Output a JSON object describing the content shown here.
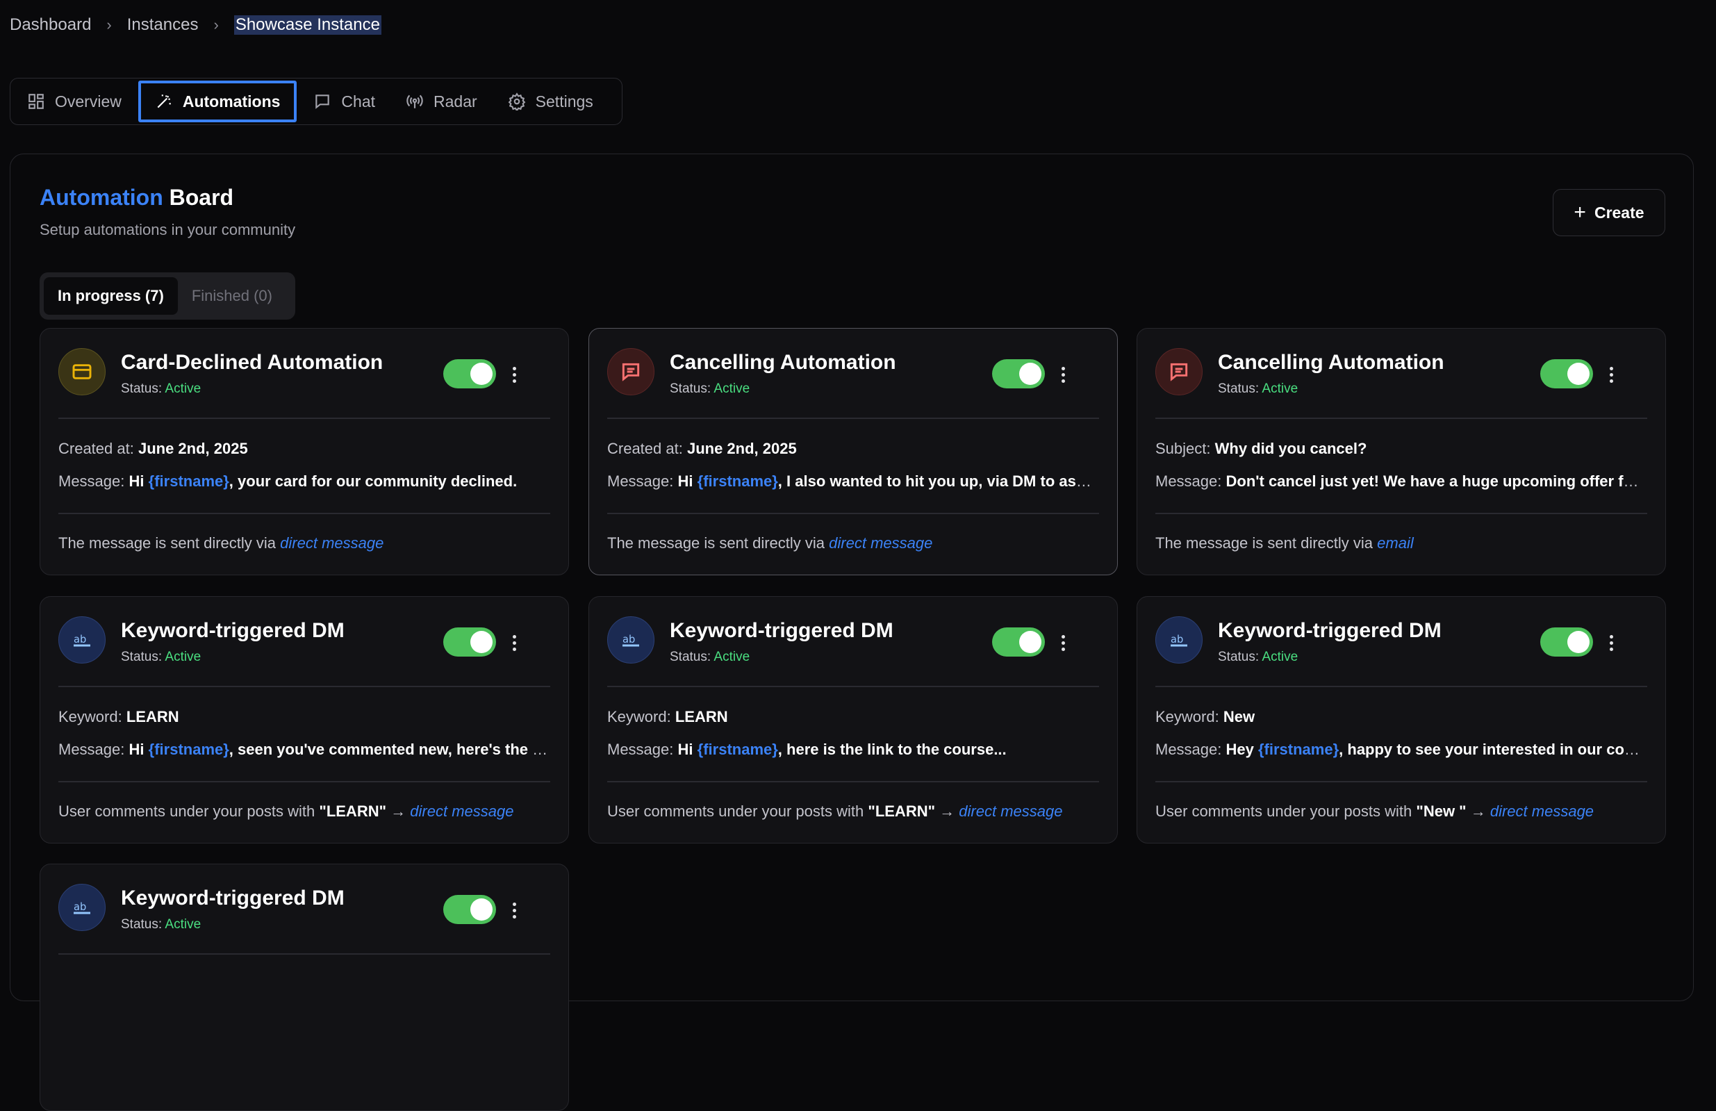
{
  "breadcrumb": {
    "items": [
      "Dashboard",
      "Instances",
      "Showcase Instance"
    ]
  },
  "tabs": [
    {
      "label": "Overview",
      "icon": "grid-icon"
    },
    {
      "label": "Automations",
      "icon": "magic-wand-icon",
      "active": true
    },
    {
      "label": "Chat",
      "icon": "chat-icon"
    },
    {
      "label": "Radar",
      "icon": "radar-icon"
    },
    {
      "label": "Settings",
      "icon": "gear-icon"
    }
  ],
  "board": {
    "title_accent": "Automation",
    "title_rest": "Board",
    "subtitle": "Setup automations in your community",
    "create_label": "Create",
    "segments": [
      "In progress (7)",
      "Finished (0)"
    ]
  },
  "cards": [
    {
      "title": "Card-Declined Automation",
      "status_label": "Status:",
      "status": "Active",
      "icon": "credit-card-icon",
      "r1_label": "Created at:",
      "r1_value": "June 2nd, 2025",
      "r2_label": "Message:",
      "r2_pre": "Hi",
      "r2_var": "{firstname}",
      "r2_rest": ", your card for our community declined.",
      "foot_text": "The message is sent directly via",
      "foot_kw": "",
      "foot_arrow": "",
      "foot_via": "direct message"
    },
    {
      "title": "Cancelling Automation",
      "status_label": "Status:",
      "status": "Active",
      "icon": "message-square-icon",
      "r1_label": "Created at:",
      "r1_value": "June 2nd, 2025",
      "r2_label": "Message:",
      "r2_pre": "Hi",
      "r2_var": "{firstname}",
      "r2_rest": ", I also wanted to hit you up, via DM to ask why you cancelled",
      "foot_text": "The message is sent directly via",
      "foot_kw": "",
      "foot_arrow": "",
      "foot_via": "direct message"
    },
    {
      "title": "Cancelling Automation",
      "status_label": "Status:",
      "status": "Active",
      "icon": "message-square-icon",
      "r1_label": "Subject:",
      "r1_value": "Why did you cancel?",
      "r2_label": "Message:",
      "r2_pre": "Don't cancel just yet! We have a huge upcoming offer for you",
      "r2_var": "",
      "r2_rest": "",
      "foot_text": "The message is sent directly via",
      "foot_kw": "",
      "foot_arrow": "",
      "foot_via": "email"
    },
    {
      "title": "Keyword-triggered DM",
      "status_label": "Status:",
      "status": "Active",
      "icon": "text-ab-icon",
      "r1_label": "Keyword:",
      "r1_value": "LEARN",
      "r2_label": "Message:",
      "r2_pre": "Hi",
      "r2_var": "{firstname}",
      "r2_rest": ", seen you've commented new, here's the link",
      "foot_text": "User comments under your posts with",
      "foot_kw": "\"LEARN\"",
      "foot_arrow": "→",
      "foot_via": "direct message"
    },
    {
      "title": "Keyword-triggered DM",
      "status_label": "Status:",
      "status": "Active",
      "icon": "text-ab-icon",
      "r1_label": "Keyword:",
      "r1_value": "LEARN",
      "r2_label": "Message:",
      "r2_pre": "Hi",
      "r2_var": "{firstname}",
      "r2_rest": ", here is the link to the course...",
      "foot_text": "User comments under your posts with",
      "foot_kw": "\"LEARN\"",
      "foot_arrow": "→",
      "foot_via": "direct message"
    },
    {
      "title": "Keyword-triggered DM",
      "status_label": "Status:",
      "status": "Active",
      "icon": "text-ab-icon",
      "r1_label": "Keyword:",
      "r1_value": "New",
      "r2_label": "Message:",
      "r2_pre": "Hey",
      "r2_var": "{firstname}",
      "r2_rest": ", happy to see your interested in our community",
      "foot_text": "User comments under your posts with",
      "foot_kw": "\"New \"",
      "foot_arrow": "→",
      "foot_via": "direct message"
    },
    {
      "title": "Keyword-triggered DM",
      "status_label": "Status:",
      "status": "Active",
      "icon": "text-ab-icon"
    }
  ]
}
